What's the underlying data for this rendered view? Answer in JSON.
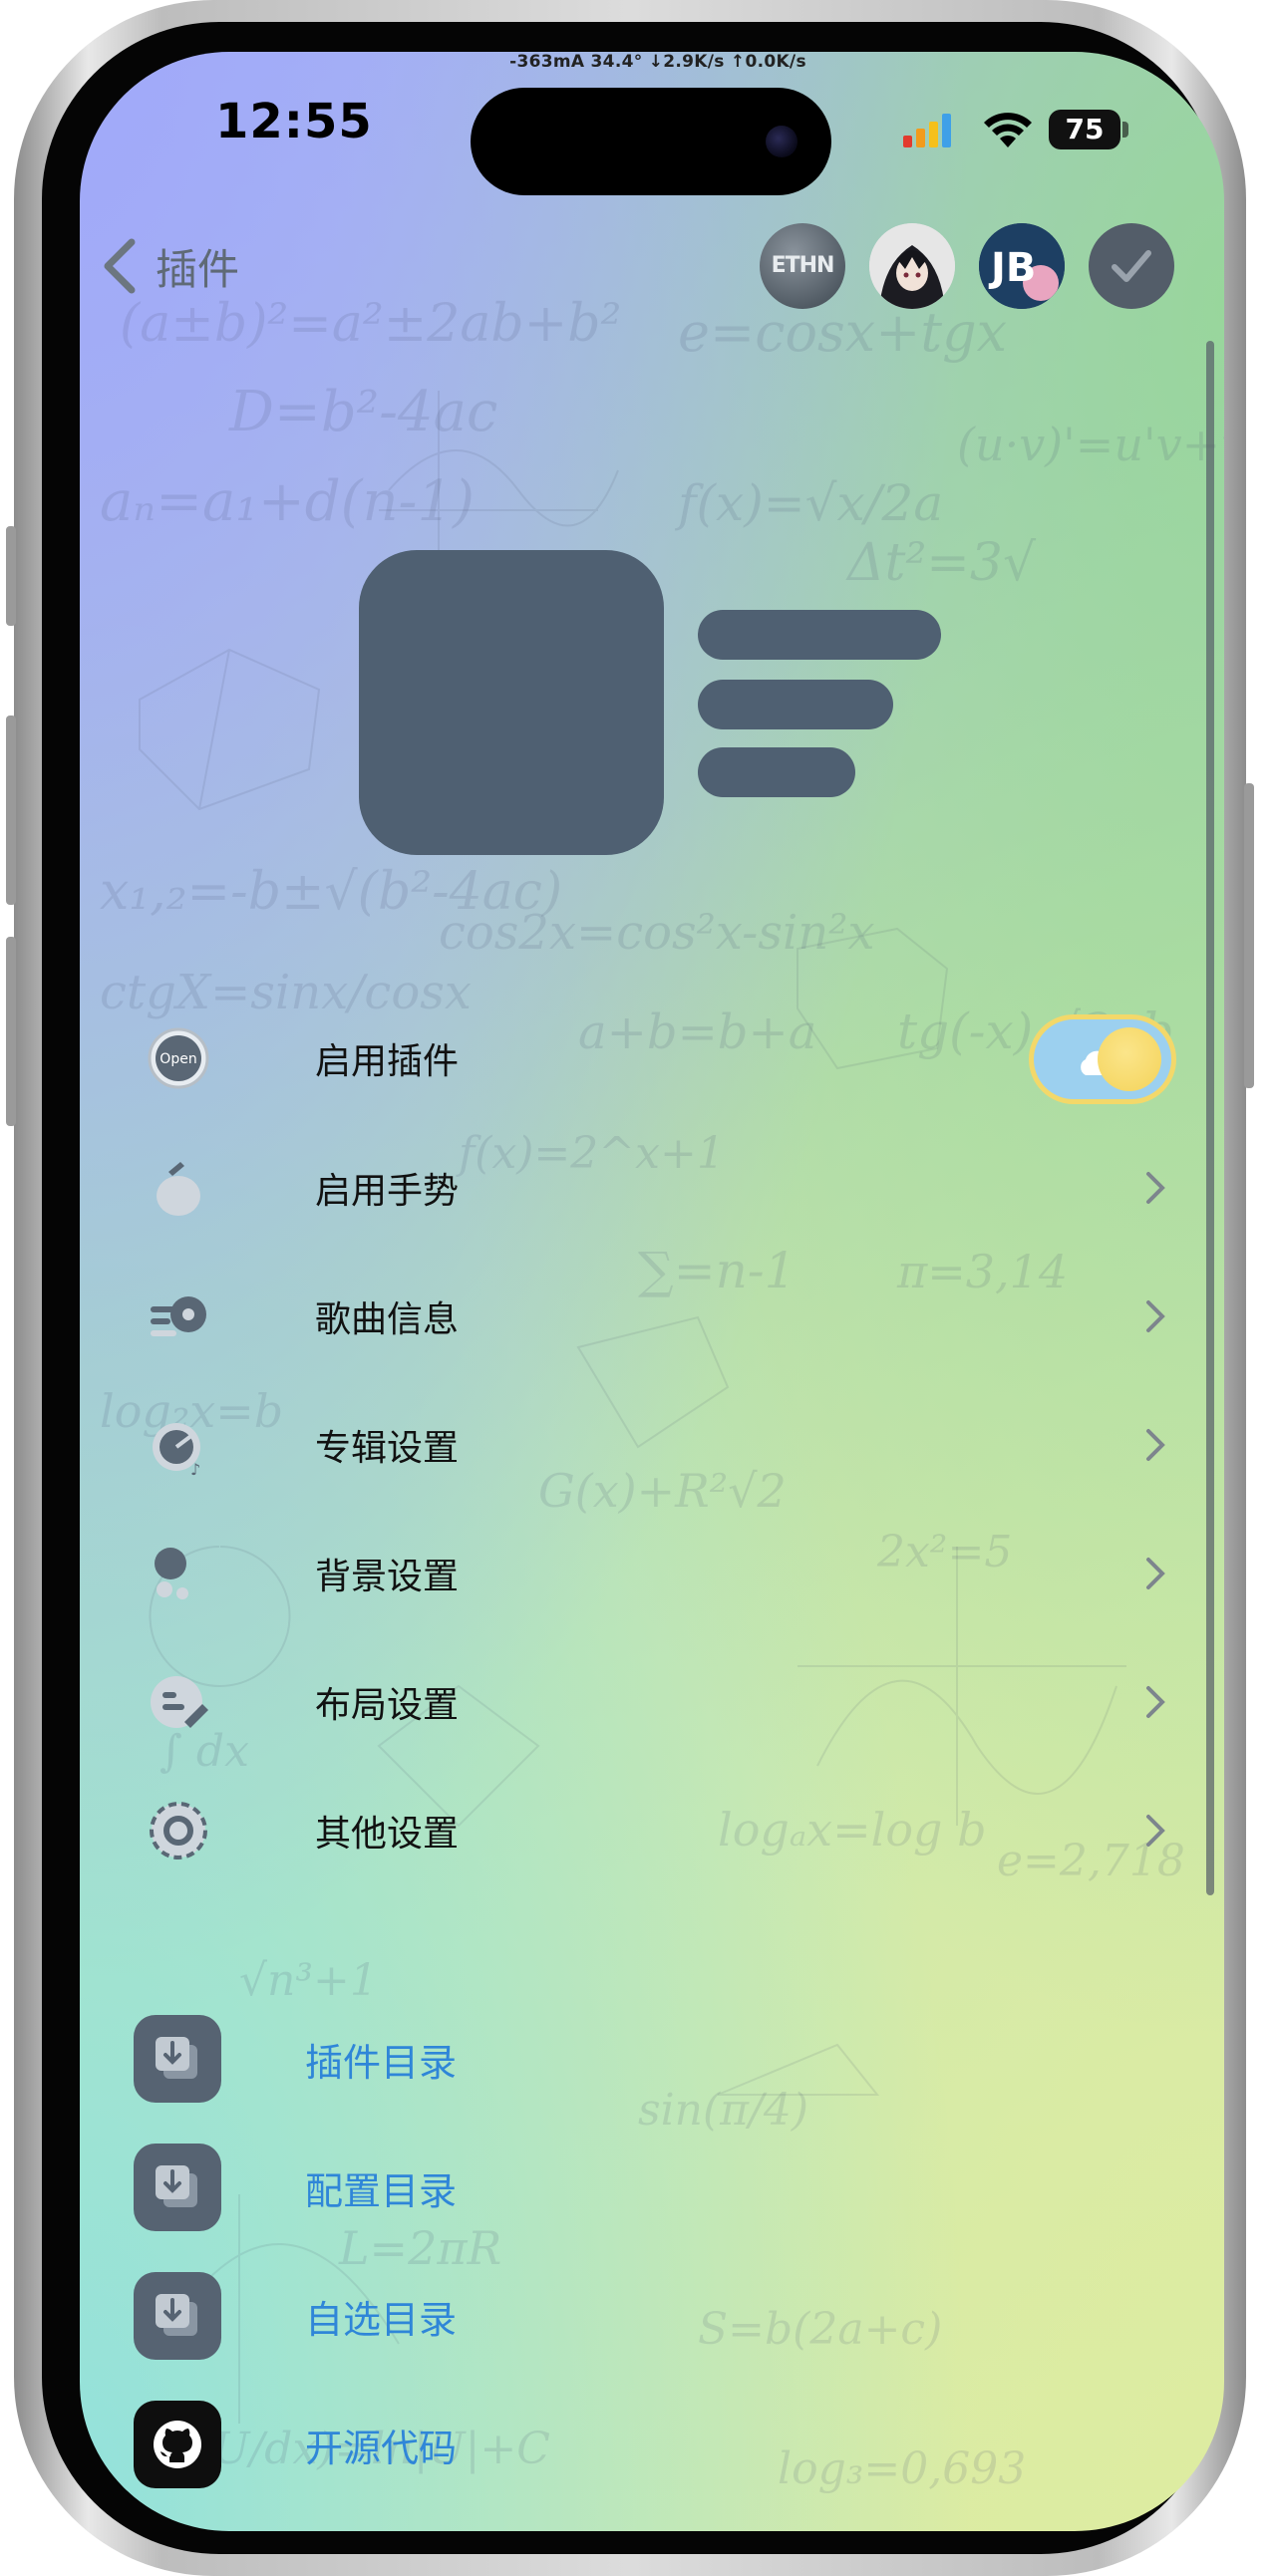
{
  "status_bar": {
    "info": "-363mA  34.4°  ↓2.9K/s ↑0.0K/s",
    "time": "12:55",
    "battery": "75"
  },
  "nav": {
    "title": "插件",
    "icons": [
      {
        "name": "eth-icon",
        "text": "ETHN"
      },
      {
        "name": "avatar-icon"
      },
      {
        "name": "jb-icon",
        "text": "JB"
      },
      {
        "name": "check-icon"
      }
    ]
  },
  "settings": [
    {
      "icon": "open-icon",
      "icon_text": "Open",
      "label": "启用插件",
      "control": "toggle",
      "toggle_on": true
    },
    {
      "icon": "gesture-icon",
      "label": "启用手势",
      "control": "chevron"
    },
    {
      "icon": "song-info-icon",
      "label": "歌曲信息",
      "control": "chevron"
    },
    {
      "icon": "album-icon",
      "label": "专辑设置",
      "control": "chevron"
    },
    {
      "icon": "background-icon",
      "label": "背景设置",
      "control": "chevron"
    },
    {
      "icon": "layout-icon",
      "label": "布局设置",
      "control": "chevron"
    },
    {
      "icon": "other-settings-icon",
      "label": "其他设置",
      "control": "chevron"
    }
  ],
  "links": [
    {
      "icon": "folder-download-icon",
      "label": "插件目录"
    },
    {
      "icon": "folder-download-icon",
      "label": "配置目录"
    },
    {
      "icon": "folder-download-icon",
      "label": "自选目录"
    },
    {
      "icon": "github-icon",
      "label": "开源代码"
    }
  ],
  "colors": {
    "link": "#2f86d8",
    "icon_fill": "#566372",
    "toggle_track": "#9cd0ef",
    "toggle_knob": "#f4d35a"
  }
}
